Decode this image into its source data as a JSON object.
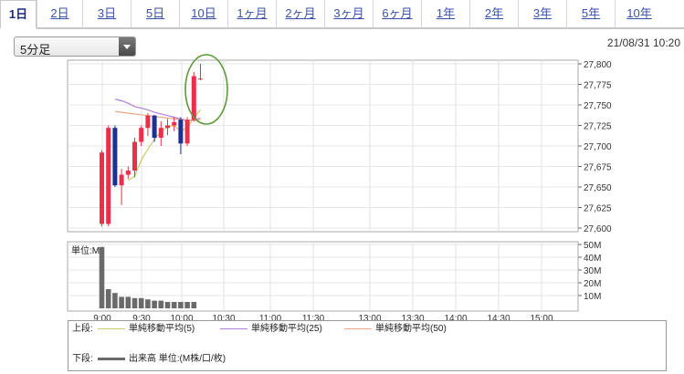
{
  "tabs": [
    {
      "label": "1日",
      "active": true
    },
    {
      "label": "2日"
    },
    {
      "label": "3日"
    },
    {
      "label": "5日"
    },
    {
      "label": "10日"
    },
    {
      "label": "1ヶ月"
    },
    {
      "label": "2ヶ月"
    },
    {
      "label": "3ヶ月"
    },
    {
      "label": "6ヶ月"
    },
    {
      "label": "1年"
    },
    {
      "label": "2年"
    },
    {
      "label": "3年"
    },
    {
      "label": "5年"
    },
    {
      "label": "10年"
    }
  ],
  "interval_select": {
    "value": "5分足"
  },
  "timestamp": "21/08/31 10:20",
  "colors": {
    "up": "#e8304a",
    "down": "#1f2f9a",
    "ma5": "#c8cc6a",
    "ma25": "#b27ed8",
    "ma50": "#e8a888",
    "volume": "#6a6a6a",
    "highlight": "#5a9a3a"
  },
  "chart_data": {
    "type": "candlestick",
    "price_axis": {
      "ylim": [
        27600,
        27800
      ],
      "ticks": [
        "27,800",
        "27,775",
        "27,750",
        "27,725",
        "27,700",
        "27,675",
        "27,650",
        "27,625",
        "27,600"
      ]
    },
    "volume_axis": {
      "unit_label": "単位:M",
      "ylim": [
        0,
        50
      ],
      "ticks": [
        "50M",
        "40M",
        "30M",
        "20M",
        "10M"
      ]
    },
    "x_ticks": [
      "9:00",
      "9:30",
      "10:00",
      "10:30",
      "11:00",
      "11:30",
      "13:00",
      "13:30",
      "14:00",
      "14:30",
      "15:00"
    ],
    "candles": [
      {
        "open": 27605,
        "high": 27695,
        "low": 27602,
        "close": 27692
      },
      {
        "open": 27605,
        "high": 27725,
        "low": 27602,
        "close": 27722
      },
      {
        "open": 27722,
        "high": 27725,
        "low": 27650,
        "close": 27652
      },
      {
        "open": 27652,
        "high": 27672,
        "low": 27628,
        "close": 27665
      },
      {
        "open": 27665,
        "high": 27675,
        "low": 27660,
        "close": 27670
      },
      {
        "open": 27670,
        "high": 27710,
        "low": 27662,
        "close": 27705
      },
      {
        "open": 27705,
        "high": 27725,
        "low": 27700,
        "close": 27722
      },
      {
        "open": 27722,
        "high": 27740,
        "low": 27712,
        "close": 27737
      },
      {
        "open": 27737,
        "high": 27738,
        "low": 27705,
        "close": 27710
      },
      {
        "open": 27710,
        "high": 27730,
        "low": 27700,
        "close": 27722
      },
      {
        "open": 27722,
        "high": 27733,
        "low": 27713,
        "close": 27725
      },
      {
        "open": 27725,
        "high": 27735,
        "low": 27718,
        "close": 27729
      },
      {
        "open": 27732,
        "high": 27735,
        "low": 27690,
        "close": 27703
      },
      {
        "open": 27703,
        "high": 27735,
        "low": 27700,
        "close": 27732
      },
      {
        "open": 27732,
        "high": 27790,
        "low": 27730,
        "close": 27785
      },
      {
        "open": 27782,
        "high": 27800,
        "low": 27780,
        "close": 27782
      }
    ],
    "ma_series": [
      {
        "name": "単純移動平均(5)",
        "values": [
          null,
          null,
          null,
          null,
          27658,
          27663,
          27683,
          27696,
          27708,
          27718,
          27723,
          27725,
          27718,
          27722,
          27734,
          27744
        ]
      },
      {
        "name": "単純移動平均(25)",
        "values": [
          null,
          null,
          27757,
          27755,
          27752,
          27748,
          27746,
          27744,
          27741,
          27739,
          27737,
          27735,
          27733,
          27731,
          27732,
          27734
        ]
      },
      {
        "name": "単純移動平均(50)",
        "values": [
          null,
          null,
          27742,
          27741,
          27740,
          27739,
          27738,
          27737,
          27736,
          27735,
          27734,
          27733,
          27732,
          27731,
          27731,
          27732
        ]
      }
    ],
    "volumes": [
      48,
      15,
      12,
      9,
      9,
      8,
      8,
      7,
      6,
      6,
      5,
      5,
      5,
      5,
      5,
      0
    ],
    "highlight": "circle around latest candles"
  },
  "legend": {
    "upper_prefix": "上段:",
    "lower_prefix": "下段:",
    "volume_label": "出来高 単位:(M株/口/枚)"
  }
}
